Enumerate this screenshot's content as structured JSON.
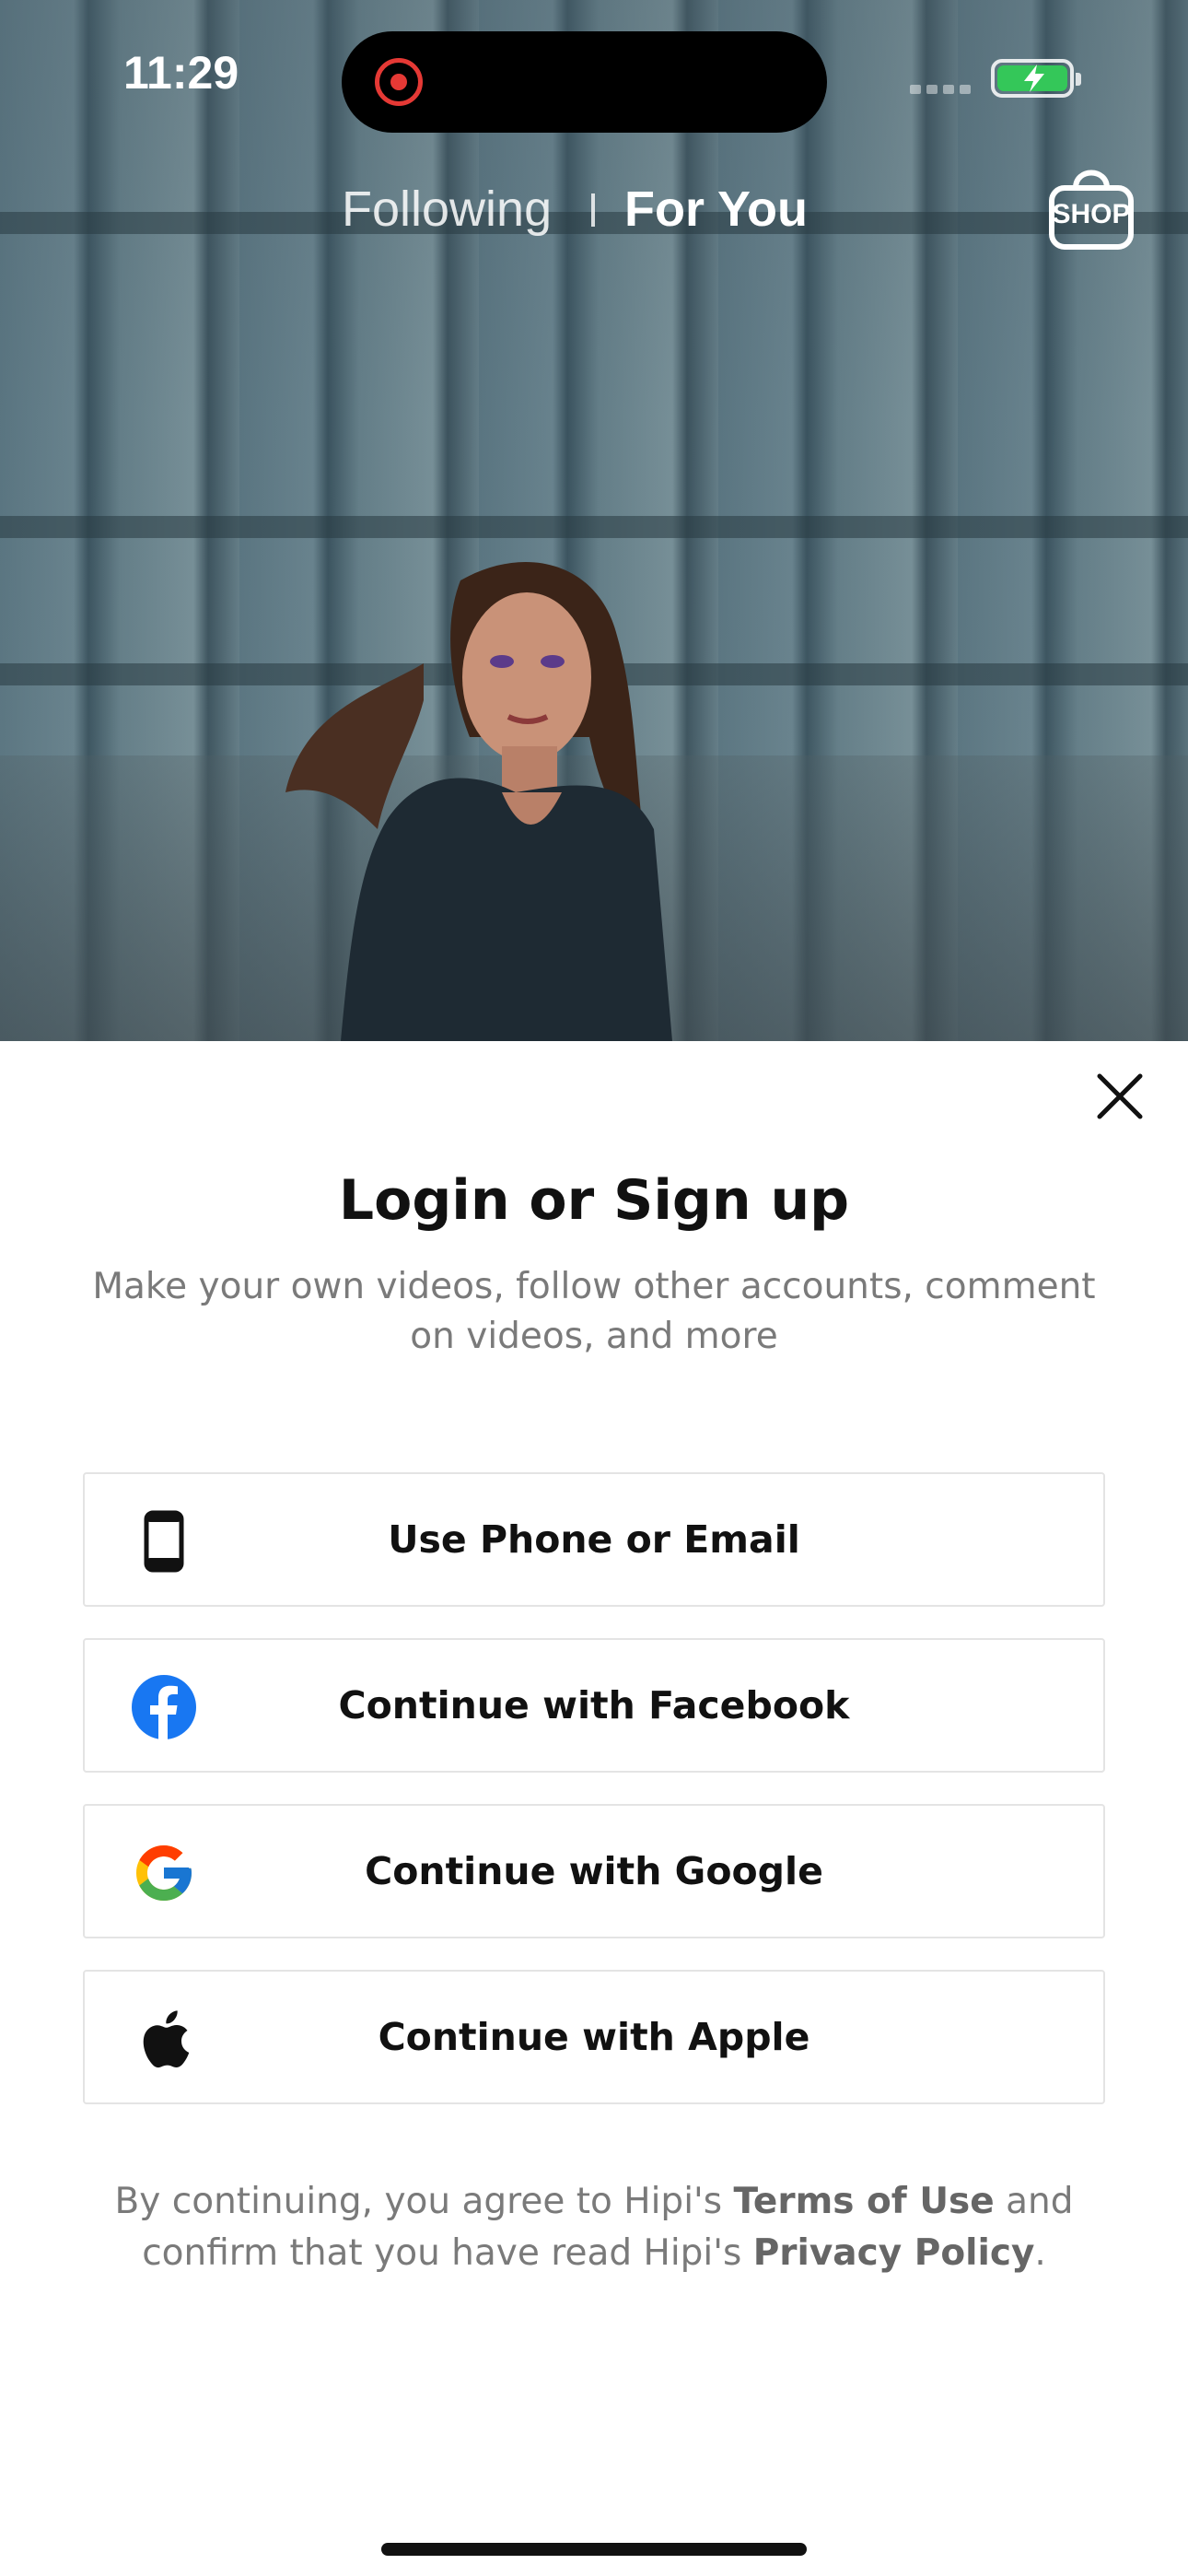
{
  "status_bar": {
    "time": "11:29"
  },
  "feed_tabs": {
    "following": "Following",
    "for_you": "For You",
    "shop": "SHOP"
  },
  "login_sheet": {
    "title": "Login or Sign up",
    "subtitle": "Make your own videos, follow other accounts, comment on videos, and more",
    "buttons": [
      {
        "label": "Use Phone or Email",
        "icon": "phone-icon"
      },
      {
        "label": "Continue with Facebook",
        "icon": "facebook-icon"
      },
      {
        "label": "Continue with Google",
        "icon": "google-icon"
      },
      {
        "label": "Continue with Apple",
        "icon": "apple-icon"
      }
    ],
    "legal": {
      "part1": "By continuing, you agree to Hipi's ",
      "terms": "Terms of Use",
      "part2": " and confirm that you have read Hipi's ",
      "privacy": "Privacy Policy",
      "part3": "."
    }
  },
  "colors": {
    "facebook": "#1877F2",
    "recording": "#e53935",
    "battery": "#34c759",
    "subtitle_text": "#7a7a7a"
  }
}
